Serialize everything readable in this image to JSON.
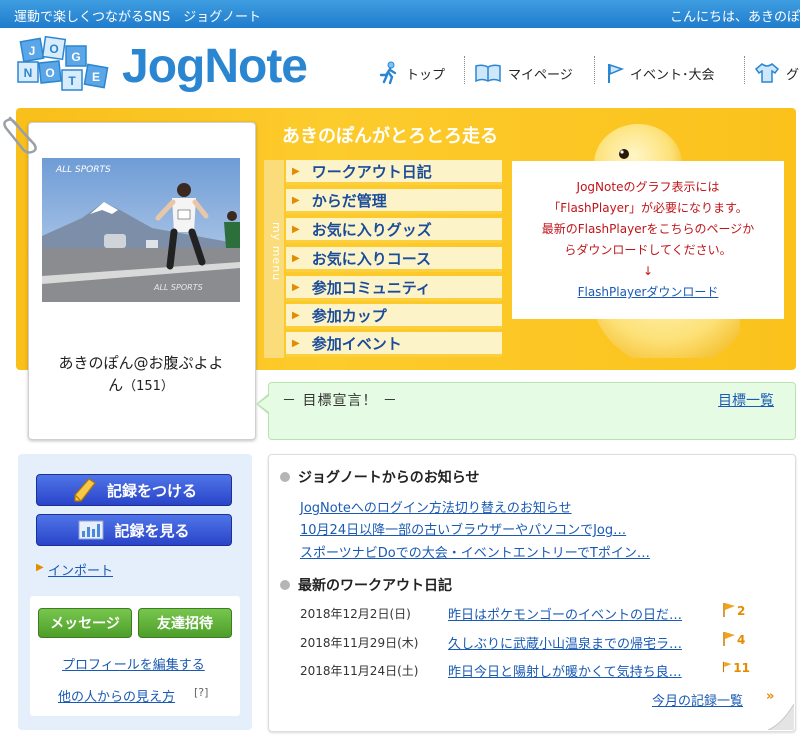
{
  "topbar": {
    "tagline": "運動で楽しくつながるSNS　ジョグノート",
    "greeting": "こんにちは、あきのぽ"
  },
  "header": {
    "logo_text": "JogNote",
    "logo_cube_letters": [
      "J",
      "O",
      "G",
      "N",
      "O",
      "T",
      "E"
    ],
    "nav": [
      {
        "label": "トップ",
        "icon": "runner-icon"
      },
      {
        "label": "マイページ",
        "icon": "book-icon"
      },
      {
        "label": "イベント･大会",
        "icon": "flag-icon"
      },
      {
        "label": "グ",
        "icon": "shirt-icon"
      }
    ]
  },
  "banner": {
    "title": "あきのぽんがとろとろ走る",
    "mymenu_label": "my menu",
    "menu": [
      "ワークアウト日記",
      "からだ管理",
      "お気に入りグッズ",
      "お気に入りコース",
      "参加コミュニティ",
      "参加カップ",
      "参加イベント"
    ],
    "flash_notice": {
      "line1": "JogNoteのグラフ表示には",
      "line2": "「FlashPlayer」が必要になります。",
      "line3": "最新のFlashPlayerをこちらのページか",
      "line4": "らダウンロードしてください。",
      "arrow": "↓",
      "link": "FlashPlayerダウンロード"
    }
  },
  "profile": {
    "name": "あきのぽん@お腹ぷよよ",
    "name_cont": "ん",
    "count": "（151）",
    "photo_watermark": "ALL SPORTS"
  },
  "goal": {
    "text": "－ 目標宣言！ －",
    "link": "目標一覧"
  },
  "actions": {
    "record_button": "記録をつける",
    "view_button": "記録を見る",
    "import_link": "インポート",
    "message_button": "メッセージ",
    "invite_button": "友達招待",
    "edit_profile_link": "プロフィールを編集する",
    "appearance_link": "他の人からの見え方",
    "help_mark": "[?]"
  },
  "news": {
    "title": "ジョグノートからのお知らせ",
    "items": [
      "JogNoteへのログイン方法切り替えのお知らせ",
      "10月24日以降一部の古いブラウザーやパソコンでJog…",
      "スポーツナビDoでの大会・イベントエントリーでTポイン…"
    ]
  },
  "workouts": {
    "title": "最新のワークアウト日記",
    "items": [
      {
        "date": "2018年12月2日(日)",
        "title": "昨日はポケモンゴーのイベントの日だ…",
        "count": "2"
      },
      {
        "date": "2018年11月29日(木)",
        "title": "久しぶりに武蔵小山温泉までの帰宅ラ…",
        "count": "4"
      },
      {
        "date": "2018年11月24日(土)",
        "title": "昨日今日と陽射しが暖かくて気持ち良…",
        "count": "11"
      }
    ],
    "monthly_link": "今月の記録一覧",
    "monthly_arrow": "»"
  },
  "colors": {
    "brand_blue": "#2b86d2",
    "banner_yellow": "#fbc21c",
    "button_blue": "#2a44c9",
    "button_green": "#4d9e2a",
    "link_blue": "#1a5ab4",
    "notice_red": "#c0141a"
  }
}
